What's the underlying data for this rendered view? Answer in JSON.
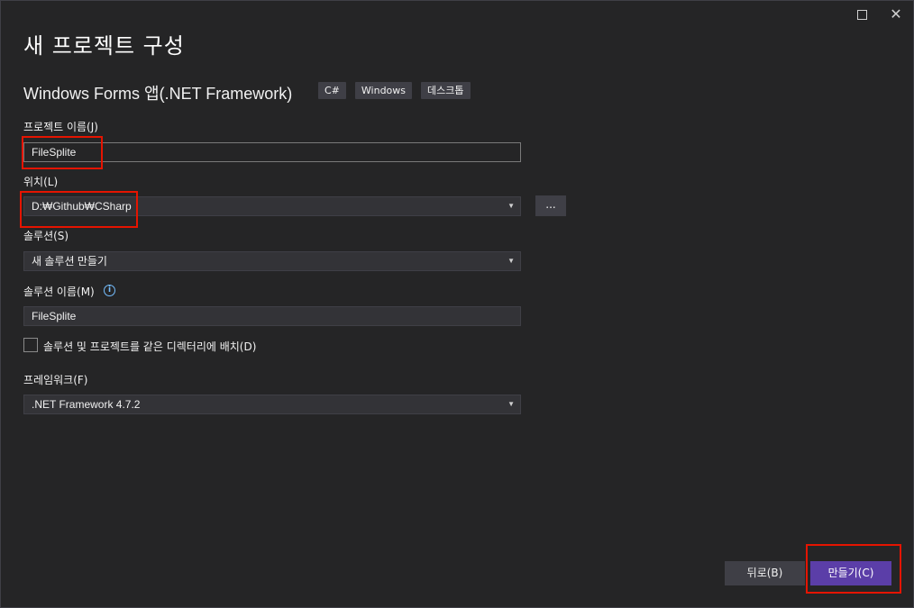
{
  "window": {
    "title": "새 프로젝트 구성",
    "maximize_icon": "maximize-icon",
    "close_icon": "close-icon",
    "close_glyph": "✕"
  },
  "template": {
    "name": "Windows Forms 앱(.NET Framework)",
    "tags": [
      "C#",
      "Windows",
      "데스크톱"
    ]
  },
  "form": {
    "project_name": {
      "label": "프로젝트 이름(J)",
      "value": "FileSplite"
    },
    "location": {
      "label": "위치(L)",
      "value": "D:₩Github₩CSharp",
      "browse_label": "..."
    },
    "solution": {
      "label": "솔루션(S)",
      "value": "새 솔루션 만들기"
    },
    "solution_name": {
      "label": "솔루션 이름(M)",
      "value": "FileSplite",
      "info_icon": "info-icon",
      "info_glyph": "i"
    },
    "same_directory": {
      "label": "솔루션 및 프로젝트를 같은 디렉터리에 배치(D)",
      "checked": false
    },
    "framework": {
      "label": "프레임워크(F)",
      "value": ".NET Framework 4.7.2"
    }
  },
  "buttons": {
    "back": "뒤로(B)",
    "create": "만들기(C)"
  },
  "colors": {
    "background": "#252526",
    "accent": "#5b3ea8",
    "highlight": "#e51400",
    "info": "#75beff"
  }
}
